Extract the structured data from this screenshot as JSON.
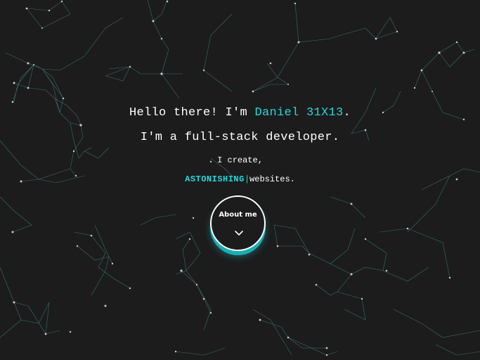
{
  "hero": {
    "greeting_prefix": "Hello there! I'm ",
    "name": "Daniel 31X13",
    "greeting_suffix": ".",
    "role": "I'm a full-stack developer.",
    "create_text": "I create,",
    "typed_word": "ASTONISHING",
    "caret": "|",
    "websites_text": "websites."
  },
  "about_button": {
    "label": "About me",
    "icon": "chevron-down-icon"
  },
  "colors": {
    "background": "#1c1c1c",
    "accent": "#22d8df",
    "text": "#ffffff",
    "network_line": "#3f8b84"
  }
}
